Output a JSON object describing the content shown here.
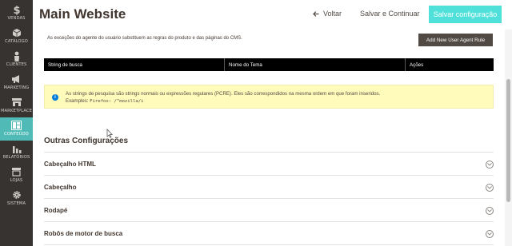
{
  "sidebar": {
    "items": [
      {
        "label": "VENDAS",
        "icon": "dollar-icon"
      },
      {
        "label": "CATÁLOGO",
        "icon": "box-icon"
      },
      {
        "label": "CLIENTES",
        "icon": "person-icon"
      },
      {
        "label": "MARKETING",
        "icon": "megaphone-icon"
      },
      {
        "label": "MARKETPLACE",
        "icon": "storefront-icon"
      },
      {
        "label": "CONTEÚDO",
        "icon": "layout-icon"
      },
      {
        "label": "RELATÓRIOS",
        "icon": "bar-chart-icon"
      },
      {
        "label": "LOJAS",
        "icon": "store-icon"
      },
      {
        "label": "SISTEMA",
        "icon": "gear-icon"
      }
    ],
    "active_index": 5,
    "bg_color": "#373330",
    "active_color": "#4fbab6"
  },
  "header": {
    "title": "Main Website",
    "back_label": "Voltar",
    "save_continue_label": "Salvar e Continuar",
    "save_config_label": "Salvar configuração",
    "accent_color": "#4fe0d9"
  },
  "user_agent": {
    "description": "As exceções do agente do usuário substituem as regras do produto e das páginas do CMS.",
    "add_rule_label": "Add New User Agent Rule",
    "table_headers": [
      "String de busca",
      "Nome do Tema",
      "Ações"
    ],
    "notice_text": "As strings de pesquisa são strings normais ou expressões regulares (PCRE). Eles são correspondidos na mesma ordem em que foram inseridos.",
    "notice_example_label": "Examples:",
    "notice_example_code": "Firefox: /^mozilla/i"
  },
  "other_settings": {
    "title": "Outras Configurações",
    "sections": [
      "Cabeçalho HTML",
      "Cabeçalho",
      "Rodapé",
      "Robôs de motor de busca"
    ]
  }
}
